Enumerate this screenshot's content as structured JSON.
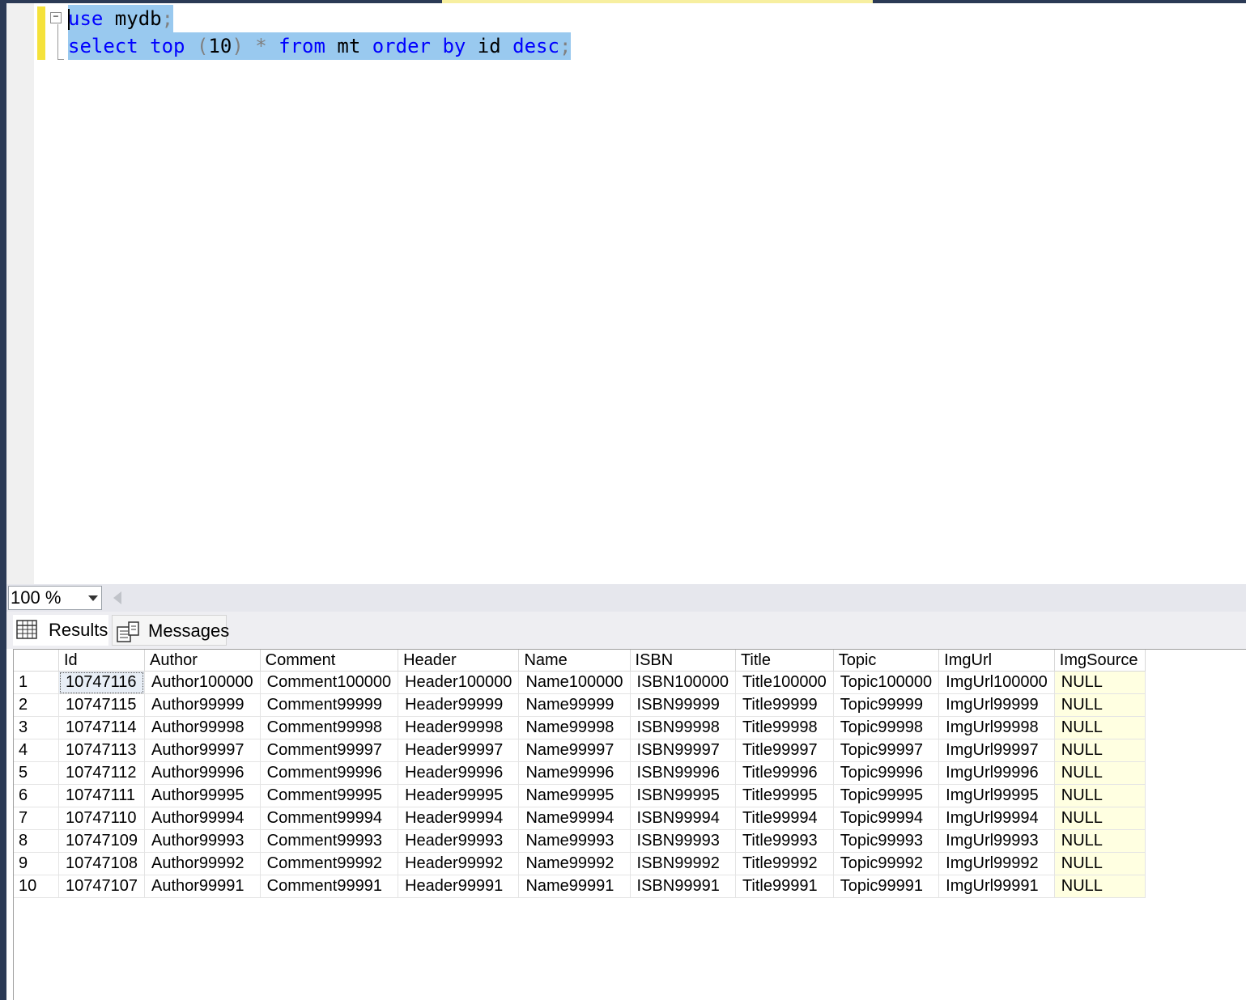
{
  "editor": {
    "lines": [
      {
        "tokens": [
          {
            "text": "use",
            "cls": "kw"
          },
          {
            "text": " mydb",
            "cls": ""
          },
          {
            "text": ";",
            "cls": "gray"
          }
        ]
      },
      {
        "tokens": [
          {
            "text": "select",
            "cls": "kw"
          },
          {
            "text": " ",
            "cls": ""
          },
          {
            "text": "top",
            "cls": "kw"
          },
          {
            "text": " ",
            "cls": ""
          },
          {
            "text": "(",
            "cls": "gray"
          },
          {
            "text": "10",
            "cls": ""
          },
          {
            "text": ")",
            "cls": "gray"
          },
          {
            "text": " ",
            "cls": ""
          },
          {
            "text": "*",
            "cls": "gray"
          },
          {
            "text": " ",
            "cls": ""
          },
          {
            "text": "from",
            "cls": "kw"
          },
          {
            "text": " mt ",
            "cls": ""
          },
          {
            "text": "order",
            "cls": "kw"
          },
          {
            "text": " ",
            "cls": ""
          },
          {
            "text": "by",
            "cls": "kw"
          },
          {
            "text": " id ",
            "cls": ""
          },
          {
            "text": "desc",
            "cls": "kw"
          },
          {
            "text": ";",
            "cls": "gray"
          }
        ]
      }
    ],
    "collapse_glyph": "−"
  },
  "zoom": {
    "value": "100 %"
  },
  "tabs": {
    "results": "Results",
    "messages": "Messages"
  },
  "grid": {
    "columns": [
      "",
      "Id",
      "Author",
      "Comment",
      "Header",
      "Name",
      "ISBN",
      "Title",
      "Topic",
      "ImgUrl",
      "ImgSource"
    ],
    "rows": [
      [
        "1",
        "10747116",
        "Author100000",
        "Comment100000",
        "Header100000",
        "Name100000",
        "ISBN100000",
        "Title100000",
        "Topic100000",
        "ImgUrl100000",
        "NULL"
      ],
      [
        "2",
        "10747115",
        "Author99999",
        "Comment99999",
        "Header99999",
        "Name99999",
        "ISBN99999",
        "Title99999",
        "Topic99999",
        "ImgUrl99999",
        "NULL"
      ],
      [
        "3",
        "10747114",
        "Author99998",
        "Comment99998",
        "Header99998",
        "Name99998",
        "ISBN99998",
        "Title99998",
        "Topic99998",
        "ImgUrl99998",
        "NULL"
      ],
      [
        "4",
        "10747113",
        "Author99997",
        "Comment99997",
        "Header99997",
        "Name99997",
        "ISBN99997",
        "Title99997",
        "Topic99997",
        "ImgUrl99997",
        "NULL"
      ],
      [
        "5",
        "10747112",
        "Author99996",
        "Comment99996",
        "Header99996",
        "Name99996",
        "ISBN99996",
        "Title99996",
        "Topic99996",
        "ImgUrl99996",
        "NULL"
      ],
      [
        "6",
        "10747111",
        "Author99995",
        "Comment99995",
        "Header99995",
        "Name99995",
        "ISBN99995",
        "Title99995",
        "Topic99995",
        "ImgUrl99995",
        "NULL"
      ],
      [
        "7",
        "10747110",
        "Author99994",
        "Comment99994",
        "Header99994",
        "Name99994",
        "ISBN99994",
        "Title99994",
        "Topic99994",
        "ImgUrl99994",
        "NULL"
      ],
      [
        "8",
        "10747109",
        "Author99993",
        "Comment99993",
        "Header99993",
        "Name99993",
        "ISBN99993",
        "Title99993",
        "Topic99993",
        "ImgUrl99993",
        "NULL"
      ],
      [
        "9",
        "10747108",
        "Author99992",
        "Comment99992",
        "Header99992",
        "Name99992",
        "ISBN99992",
        "Title99992",
        "Topic99992",
        "ImgUrl99992",
        "NULL"
      ],
      [
        "10",
        "10747107",
        "Author99991",
        "Comment99991",
        "Header99991",
        "Name99991",
        "ISBN99991",
        "Title99991",
        "Topic99991",
        "ImgUrl99991",
        "NULL"
      ]
    ]
  },
  "colors": {
    "keyword": "#0000ff",
    "punctuation": "#808080",
    "selection": "#99c9ef",
    "null_cell": "#ffffe1",
    "modified_bar": "#f5e23b"
  }
}
